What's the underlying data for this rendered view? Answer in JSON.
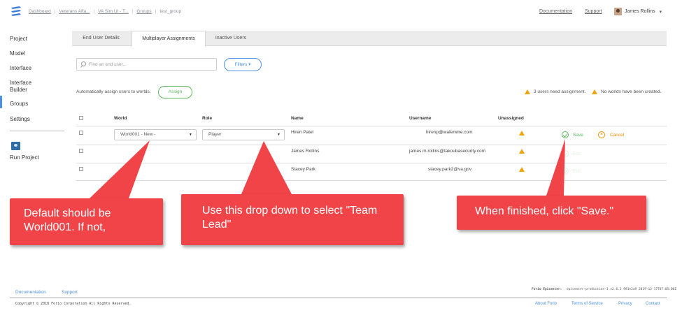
{
  "breadcrumbs": [
    "Dashboard",
    "Veterans Affa...",
    "VA Sim UI - T...",
    "Groups",
    "test_group"
  ],
  "header": {
    "documentation": "Documentation",
    "support": "Support",
    "user_name": "James Rollins",
    "user_caret": "▾"
  },
  "sidebar": {
    "items": [
      "Project",
      "Model",
      "Interface",
      "Interface",
      "Builder",
      "Groups",
      "Settings"
    ],
    "active": "Groups",
    "run_project": "Run Project"
  },
  "tabs": [
    "End User Details",
    "Multiplayer Assignments",
    "Inactive Users"
  ],
  "active_tab": "Multiplayer Assignments",
  "search": {
    "placeholder": "Find an end user..."
  },
  "filters_label": "Filters ▾",
  "auto_assign": {
    "label": "Automatically assign users to worlds.",
    "button": "Assign"
  },
  "warnings": {
    "need_assignment": "3 users need assignment.",
    "no_worlds": "No worlds have been created."
  },
  "table": {
    "columns": [
      "World",
      "Role",
      "Name",
      "Username",
      "Unassigned"
    ],
    "rows": [
      {
        "world": "World001 - New -",
        "role": "Player",
        "name": "Hiren Patel",
        "username": "hirenp@waferwire.com",
        "action1": "Save",
        "action2": "Cancel"
      },
      {
        "world": "",
        "role": "",
        "name": "James Rollins",
        "username": "james.m.rollins@takoubasecurity.com",
        "action1": "Edit",
        "action2": ""
      },
      {
        "world": "",
        "role": "",
        "name": "Stacey Park",
        "username": "stacey.park2@va.gov",
        "action1": "Edit",
        "action2": ""
      }
    ]
  },
  "callouts": {
    "world": "Default should be World001. If not,",
    "role": "Use this drop down to select \"Team Lead\"",
    "save": "When finished, click \"Save.\""
  },
  "footer": {
    "documentation": "Documentation",
    "support": "Support",
    "epicenter_label": "Forio Epicenter:",
    "epicenter_version": "epicenter-production-1 v2.6.2 981e2a9 2019-12-17T07:05:00Z",
    "copyright": "Copyright © 2018 Forio Corporation All Rights Reserved.",
    "about": "About Forio",
    "terms": "Terms of Service",
    "privacy": "Privacy",
    "contact": "Contact"
  },
  "colors": {
    "accent": "#4a90e2",
    "success": "#5cb85c",
    "warning": "#f0a30a",
    "cancel": "#f08c00",
    "callout": "#f04448"
  }
}
